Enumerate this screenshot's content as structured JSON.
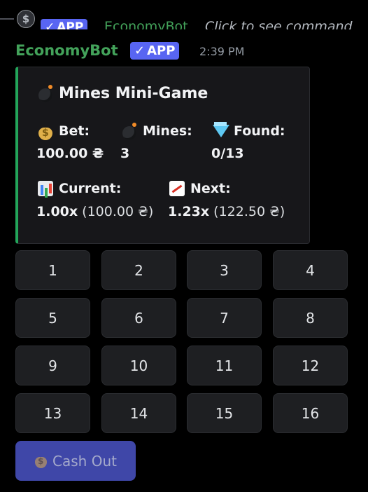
{
  "reply": {
    "avatar_icon": "dollar-coin-icon",
    "avatar_glyph": "$",
    "badge": "APP",
    "name": "EconomyBot",
    "text": "Click to see command"
  },
  "message": {
    "author": "EconomyBot",
    "badge": "APP",
    "timestamp": "2:39 PM"
  },
  "embed": {
    "accent_color": "#23a55a",
    "title": "Mines Mini-Game",
    "fields": {
      "bet": {
        "name": "Bet:",
        "value": "100.00 ₴"
      },
      "mines": {
        "name": "Mines:",
        "value": "3"
      },
      "found": {
        "name": "Found:",
        "value": "0/13"
      },
      "current": {
        "name": "Current:",
        "value_strong": "1.00x",
        "value_rest": " (100.00 ₴)"
      },
      "next": {
        "name": "Next:",
        "value_strong": "1.23x",
        "value_rest": " (122.50 ₴)"
      }
    }
  },
  "tiles": [
    "1",
    "2",
    "3",
    "4",
    "5",
    "6",
    "7",
    "8",
    "9",
    "10",
    "11",
    "12",
    "13",
    "14",
    "15",
    "16"
  ],
  "cash_out": {
    "label": "Cash Out",
    "icon": "money-bag-icon",
    "color": "#3f47a8"
  }
}
